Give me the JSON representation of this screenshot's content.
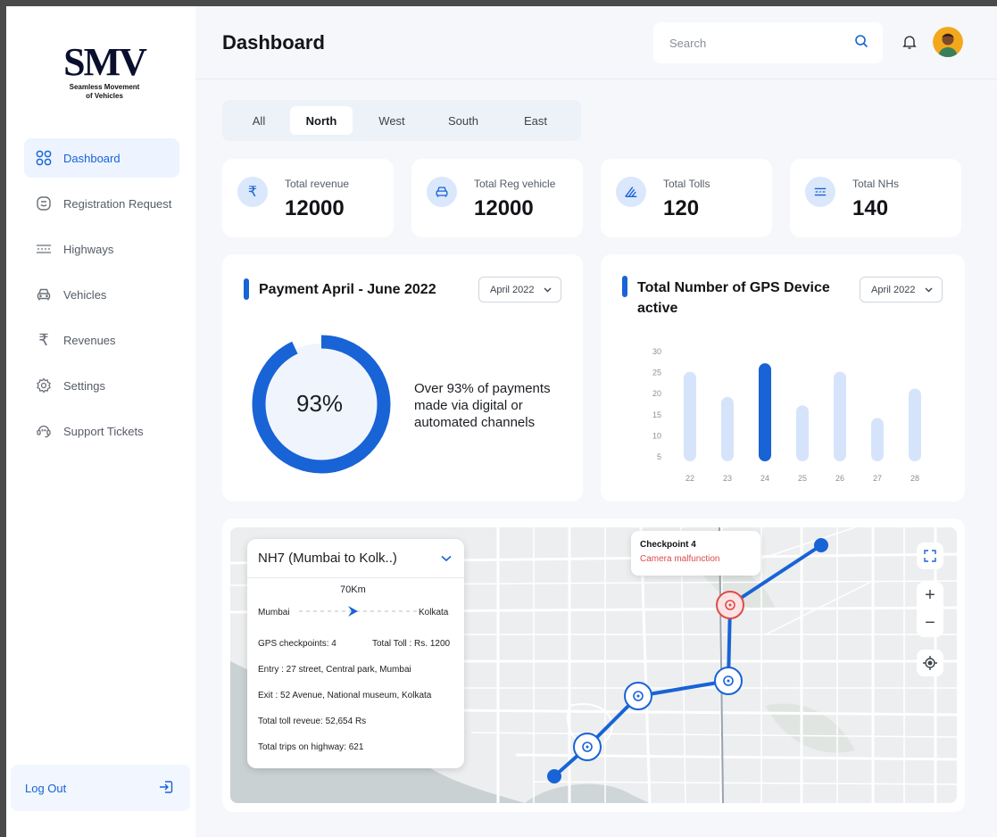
{
  "brand": {
    "mark": "SMV",
    "tagline_line1": "Seamless Movement",
    "tagline_line2": "of Vehicles"
  },
  "sidebar": {
    "items": [
      {
        "label": "Dashboard",
        "icon": "grid-icon",
        "active": true
      },
      {
        "label": "Registration Request",
        "icon": "request-icon",
        "active": false
      },
      {
        "label": "Highways",
        "icon": "highway-icon",
        "active": false
      },
      {
        "label": "Vehicles",
        "icon": "car-icon",
        "active": false
      },
      {
        "label": "Revenues",
        "icon": "rupee-icon",
        "active": false
      },
      {
        "label": "Settings",
        "icon": "gear-icon",
        "active": false
      },
      {
        "label": "Support Tickets",
        "icon": "support-icon",
        "active": false
      }
    ],
    "logout_label": "Log Out"
  },
  "header": {
    "title": "Dashboard",
    "search_placeholder": "Search"
  },
  "tabs": [
    {
      "label": "All",
      "active": false
    },
    {
      "label": "North",
      "active": true
    },
    {
      "label": "West",
      "active": false
    },
    {
      "label": "South",
      "active": false
    },
    {
      "label": "East",
      "active": false
    }
  ],
  "stats": [
    {
      "label": "Total revenue",
      "value": "12000",
      "icon": "rupee-icon"
    },
    {
      "label": "Total Reg vehicle",
      "value": "12000",
      "icon": "car-icon"
    },
    {
      "label": "Total Tolls",
      "value": "120",
      "icon": "toll-icon"
    },
    {
      "label": "Total NHs",
      "value": "140",
      "icon": "highway-icon"
    }
  ],
  "payment": {
    "title": "Payment  April - June 2022",
    "dropdown": "April 2022",
    "percent_label": "93%",
    "percent": 93,
    "desc_line1": "Over 93% of payments",
    "desc_line2": "made via digital or",
    "desc_line3": "automated channels"
  },
  "gps": {
    "title_line1": "Total Number of GPS Device",
    "title_line2": "active",
    "dropdown": "April 2022"
  },
  "chart_data": {
    "type": "bar",
    "categories": [
      "22",
      "23",
      "24",
      "25",
      "26",
      "27",
      "28"
    ],
    "values": [
      25,
      19,
      27,
      17,
      25,
      14,
      21
    ],
    "highlight_index": 2,
    "yticks": [
      "30",
      "25",
      "20",
      "15",
      "10",
      "5"
    ],
    "ylim": [
      5,
      30
    ],
    "title": "Total Number of GPS Device active",
    "grid": false
  },
  "route": {
    "name": "NH7 (Mumbai to Kolk..)",
    "distance": "70Km",
    "from": "Mumbai",
    "to": "Kolkata",
    "gps_checkpoints": "GPS checkpoints: 4",
    "total_toll": "Total Toll : Rs. 1200",
    "entry": "Entry : 27 street, Central park, Mumbai",
    "exit": "Exit : 52 Avenue, National museum, Kolkata",
    "toll_revenue": "Total toll reveue: 52,654 Rs",
    "trips": "Total trips on highway: 621"
  },
  "callout": {
    "title": "Checkpoint 4",
    "status": "Camera malfunction"
  },
  "map_controls": {
    "zoom_in": "+",
    "zoom_out": "−"
  },
  "colors": {
    "accent": "#1863d6",
    "accent_light": "#d6e4fb",
    "alert": "#e04a4a"
  }
}
